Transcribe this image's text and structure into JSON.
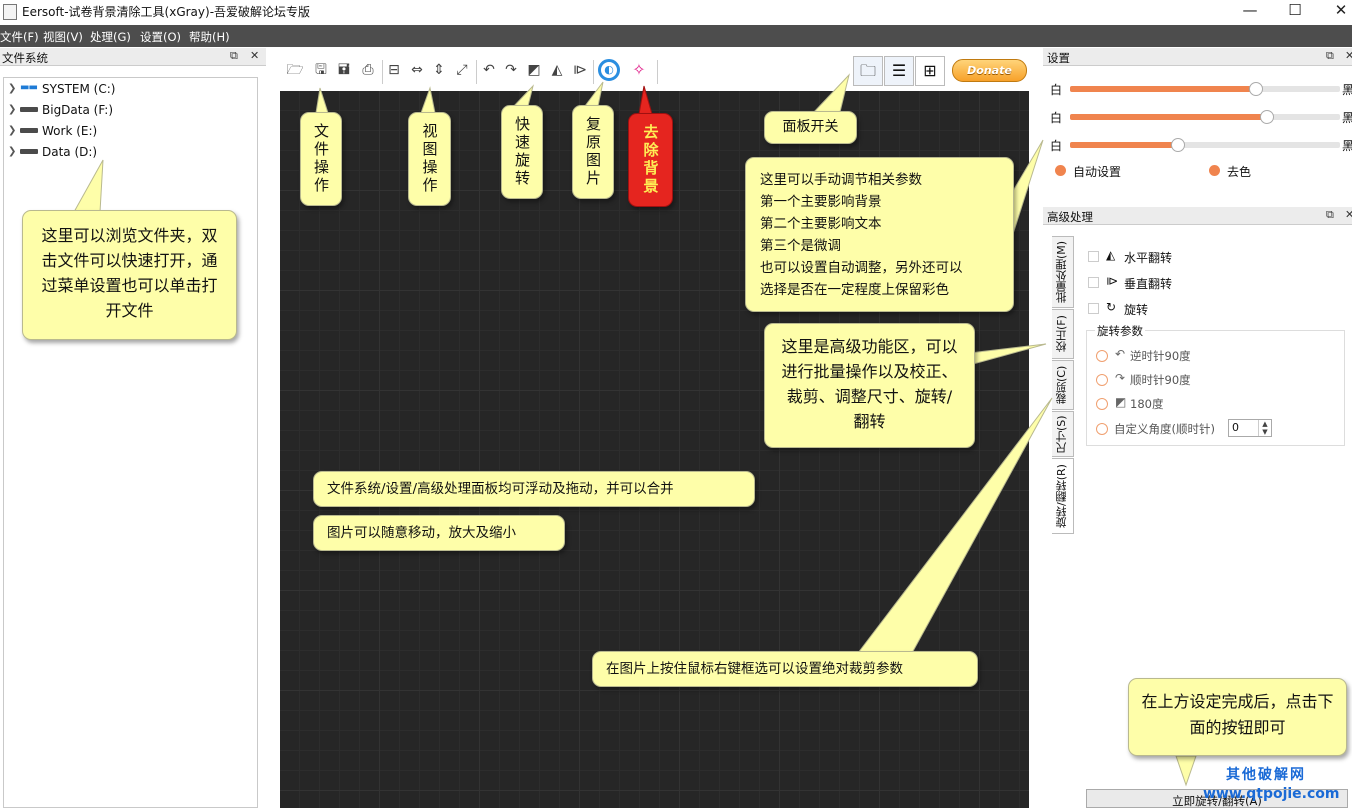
{
  "window": {
    "title": "Eersoft-试卷背景清除工具(xGray)-吾爱破解论坛专版",
    "min_icon": "minimize-icon",
    "max_icon": "maximize-icon",
    "close_icon": "close-icon"
  },
  "menu": {
    "items": [
      "文件(F)",
      "视图(V)",
      "处理(G)",
      "设置(O)",
      "帮助(H)"
    ]
  },
  "filesystem": {
    "title": "文件系统",
    "drives": [
      {
        "label": "SYSTEM (C:)",
        "icon": "windows-drive-icon"
      },
      {
        "label": "BigData (F:)",
        "icon": "drive-icon"
      },
      {
        "label": "Work (E:)",
        "icon": "drive-icon"
      },
      {
        "label": "Data (D:)",
        "icon": "drive-icon"
      }
    ]
  },
  "toolbar": {
    "groups": [
      [
        "open-folder-icon",
        "save-icon",
        "save-as-icon",
        "print-icon"
      ],
      [
        "fit-width-icon",
        "fit-horizontal-icon",
        "fit-vertical-icon",
        "fullscreen-icon"
      ],
      [
        "rotate-left-icon",
        "rotate-right-icon",
        "rotate-180-icon",
        "flip-horizontal-icon",
        "flip-vertical-icon"
      ],
      [
        "restore-image-icon",
        "magic-wand-icon"
      ]
    ]
  },
  "panel_buttons": {
    "icons": [
      "folder-panel-icon",
      "sliders-panel-icon",
      "grid-panel-icon"
    ],
    "donate_label": "Donate"
  },
  "settings": {
    "title": "设置",
    "sliders": [
      {
        "left_label": "白",
        "right_label": "黑",
        "value": 0.69
      },
      {
        "left_label": "白",
        "right_label": "黑",
        "value": 0.73
      },
      {
        "left_label": "白",
        "right_label": "黑",
        "value": 0.4
      }
    ],
    "auto_label": "自动设置",
    "decolor_label": "去色",
    "accent": "#f0844e"
  },
  "advanced": {
    "title": "高级处理",
    "tabs": [
      "批量处理(M)",
      "校正(F)",
      "裁剪(C)",
      "尺寸(S)",
      "旋转/翻转(R)"
    ],
    "options": [
      {
        "label": "水平翻转",
        "icon": "flip-horizontal-icon"
      },
      {
        "label": "垂直翻转",
        "icon": "flip-vertical-icon"
      },
      {
        "label": "旋转",
        "icon": "rotate-icon"
      }
    ],
    "rotation_group": "旋转参数",
    "rotations": [
      {
        "label": "逆时针90度",
        "icon": "rotate-left-icon"
      },
      {
        "label": "顺时针90度",
        "icon": "rotate-right-icon"
      },
      {
        "label": "180度",
        "icon": "rotate-180-icon"
      },
      {
        "label": "自定义角度(顺时针)",
        "icon": ""
      }
    ],
    "custom_angle": "0",
    "apply_button": "立即旋转/翻转(A)"
  },
  "callouts": {
    "file_ops": "文件操作",
    "view_ops": "视图操作",
    "quick_rotate": "快速旋转",
    "restore": "复原图片",
    "remove_bg": "去除背景",
    "panel_switch": "面板开关",
    "browse": "这里可以浏览文件夹，双击文件可以快速打开，通过菜单设置也可以单击打开文件",
    "settings_help": [
      "这里可以手动调节相关参数",
      "第一个主要影响背景",
      "第二个主要影响文本",
      "第三个是微调",
      "也可以设置自动调整，另外还可以",
      "选择是否在一定程度上保留彩色"
    ],
    "advanced_help": "这里是高级功能区，可以进行批量操作以及校正、裁剪、调整尺寸、旋转/翻转",
    "float_help": "文件系统/设置/高级处理面板均可浮动及拖动，并可以合并",
    "move_help": "图片可以随意移动，放大及缩小",
    "crop_help": "在图片上按住鼠标右键框选可以设置绝对裁剪参数",
    "apply_help": "在上方设定完成后，点击下面的按钮即可"
  },
  "watermark": {
    "line1": "其他破解网",
    "line2": "www.qtpojie.com"
  }
}
